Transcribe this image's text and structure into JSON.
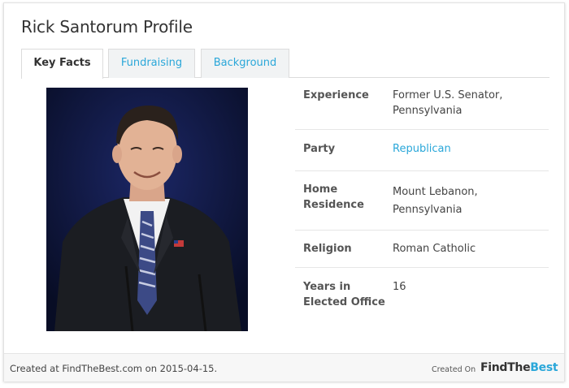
{
  "profile": {
    "title": "Rick Santorum Profile"
  },
  "tabs": [
    {
      "label": "Key Facts",
      "active": true
    },
    {
      "label": "Fundraising",
      "active": false
    },
    {
      "label": "Background",
      "active": false
    }
  ],
  "facts": [
    {
      "label": "Experience",
      "value": "Former U.S. Senator, Pennsylvania"
    },
    {
      "label": "Party",
      "value": "Republican",
      "link": true
    },
    {
      "label": "Home Residence",
      "value": "Mount Lebanon, Pennsylvania"
    },
    {
      "label": "Religion",
      "value": "Roman Catholic"
    },
    {
      "label": "Years in Elected Office",
      "value": "16"
    }
  ],
  "footer": {
    "created_text": "Created at FindTheBest.com on 2015-04-15.",
    "created_on_label": "Created On",
    "brand_find": "FindThe",
    "brand_best": "Best"
  },
  "colors": {
    "accent": "#2aa7d9",
    "photo_background": "#111a48"
  }
}
